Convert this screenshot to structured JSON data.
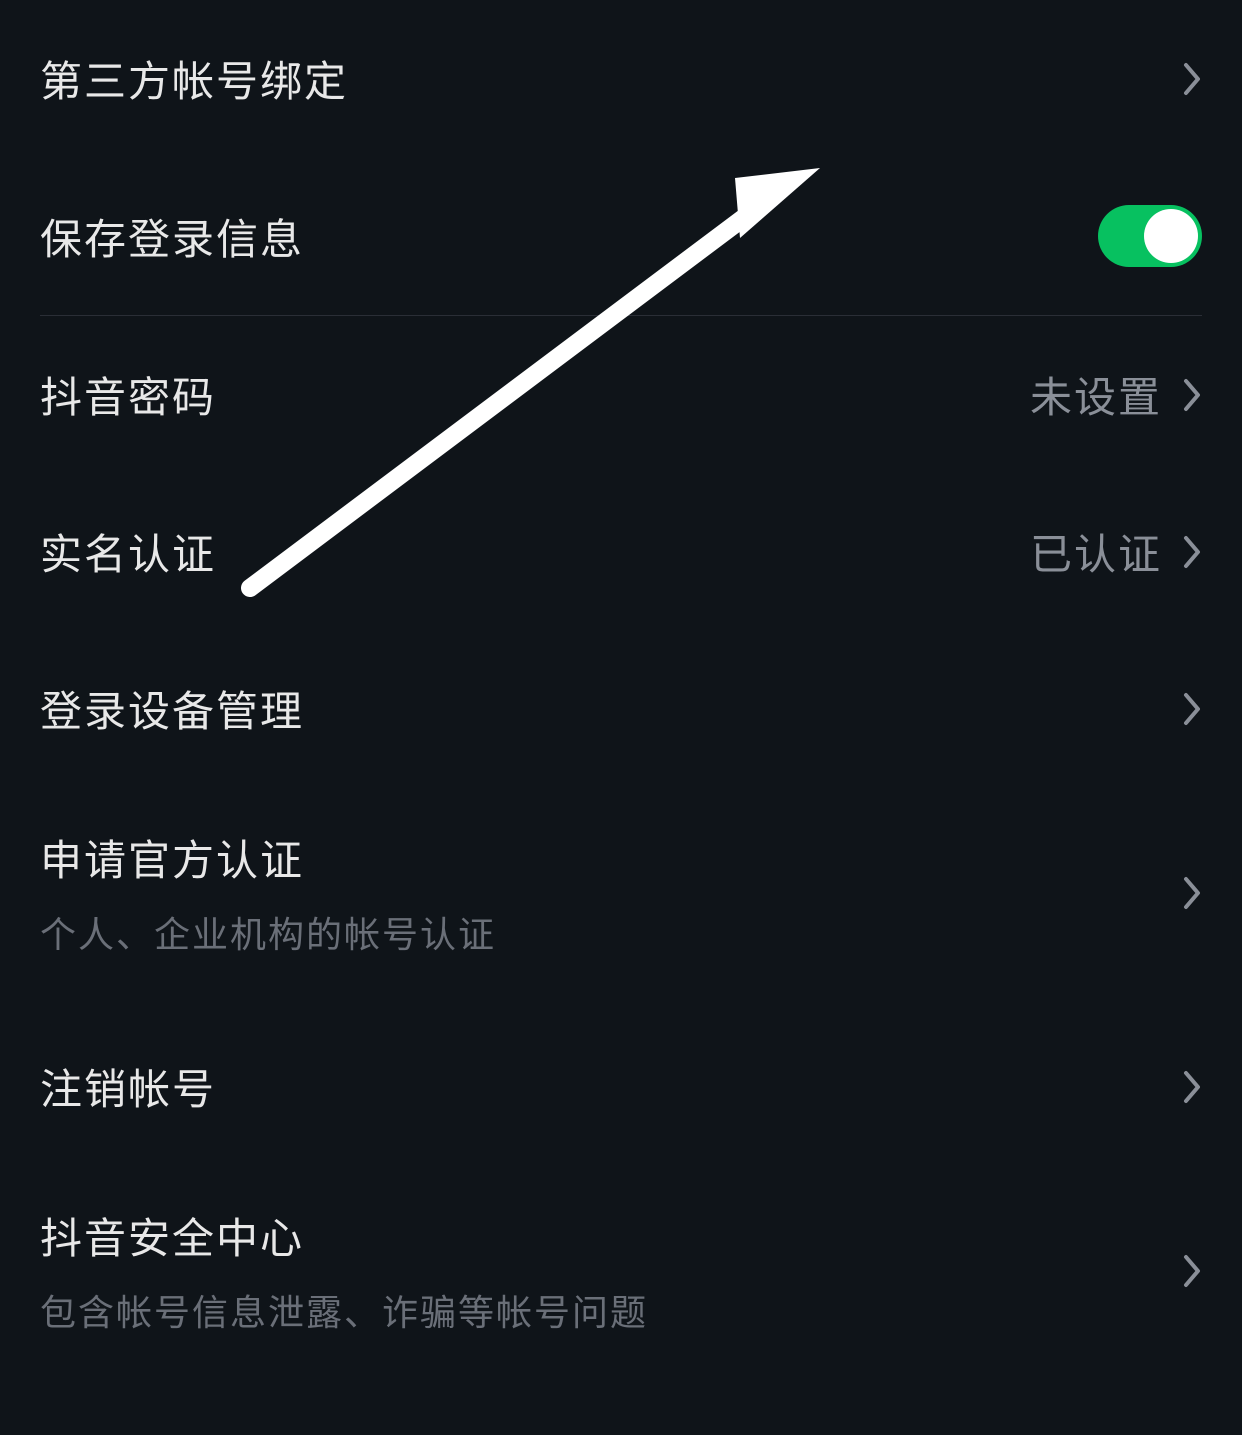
{
  "settings": {
    "items": [
      {
        "label": "第三方帐号绑定",
        "type": "nav"
      },
      {
        "label": "保存登录信息",
        "type": "toggle",
        "enabled": true
      },
      {
        "label": "抖音密码",
        "value": "未设置",
        "type": "nav"
      },
      {
        "label": "实名认证",
        "value": "已认证",
        "type": "nav"
      },
      {
        "label": "登录设备管理",
        "type": "nav"
      },
      {
        "label": "申请官方认证",
        "sublabel": "个人、企业机构的帐号认证",
        "type": "nav"
      },
      {
        "label": "注销帐号",
        "type": "nav"
      },
      {
        "label": "抖音安全中心",
        "sublabel": "包含帐号信息泄露、诈骗等帐号问题",
        "type": "nav"
      }
    ]
  }
}
